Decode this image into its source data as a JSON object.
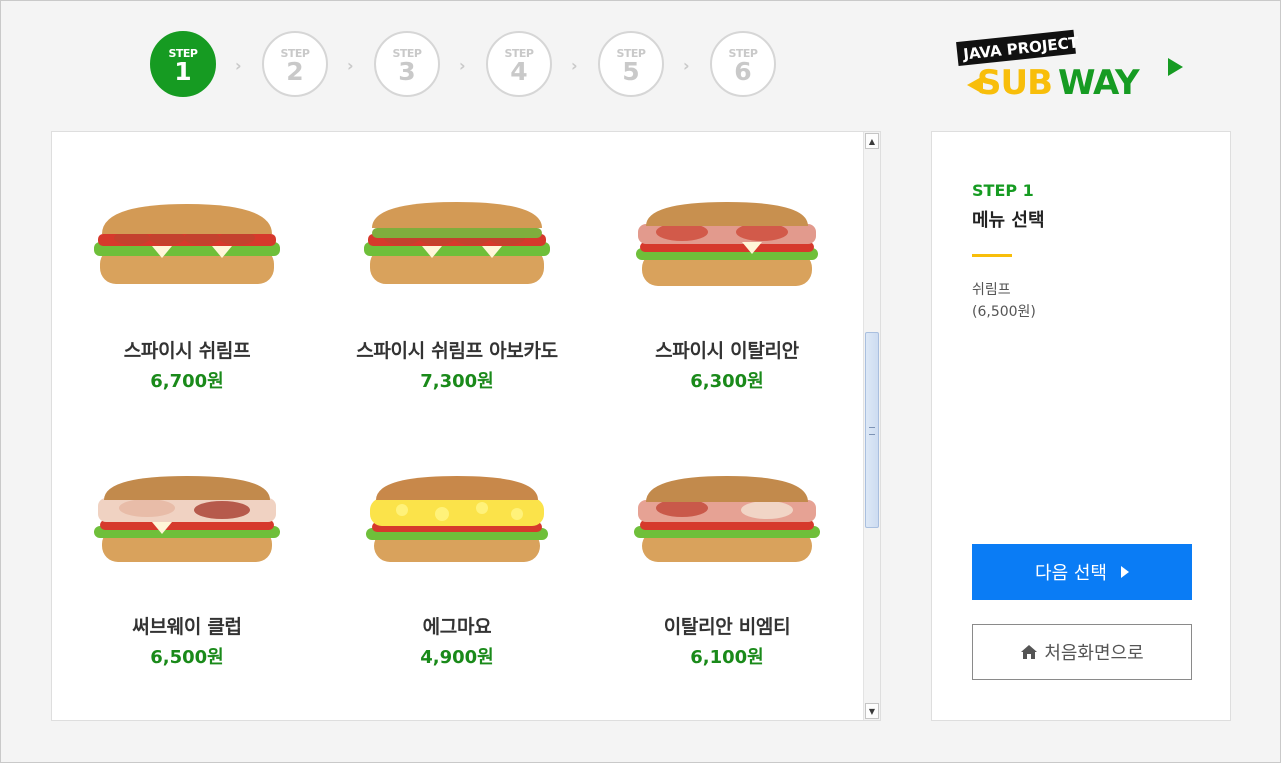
{
  "steps": [
    {
      "label": "STEP",
      "number": "1",
      "active": true
    },
    {
      "label": "STEP",
      "number": "2",
      "active": false
    },
    {
      "label": "STEP",
      "number": "3",
      "active": false
    },
    {
      "label": "STEP",
      "number": "4",
      "active": false
    },
    {
      "label": "STEP",
      "number": "5",
      "active": false
    },
    {
      "label": "STEP",
      "number": "6",
      "active": false
    }
  ],
  "logo": {
    "top_text": "JAVA PROJECT",
    "brand": "SUBWAY"
  },
  "menu": {
    "items": [
      {
        "name": "스파이시 쉬림프",
        "price": "6,700원"
      },
      {
        "name": "스파이시 쉬림프 아보카도",
        "price": "7,300원"
      },
      {
        "name": "스파이시 이탈리안",
        "price": "6,300원"
      },
      {
        "name": "써브웨이 클럽",
        "price": "6,500원"
      },
      {
        "name": "에그마요",
        "price": "4,900원"
      },
      {
        "name": "이탈리안 비엠티",
        "price": "6,100원"
      }
    ]
  },
  "side": {
    "step_label": "STEP 1",
    "title": "메뉴 선택",
    "selected_name": "쉬림프",
    "selected_price": "(6,500원)",
    "next_button": "다음 선택",
    "home_button": "처음화면으로"
  },
  "colors": {
    "accent_green": "#169b22",
    "price_green": "#1a8a1a",
    "primary_blue": "#0a7cf5",
    "highlight_yellow": "#f8be0a"
  }
}
